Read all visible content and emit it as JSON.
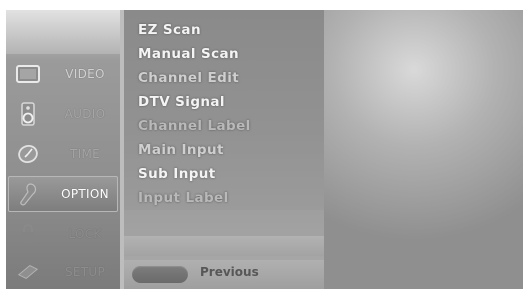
{
  "sidebar": {
    "items": [
      {
        "label": "VIDEO",
        "icon": "tv-screen-icon",
        "state": "normal"
      },
      {
        "label": "AUDIO",
        "icon": "speaker-icon",
        "state": "dim"
      },
      {
        "label": "TIME",
        "icon": "clock-icon",
        "state": "dim"
      },
      {
        "label": "OPTION",
        "icon": "option-icon",
        "state": "active"
      },
      {
        "label": "LOCK",
        "icon": "lock-icon",
        "state": "faint"
      },
      {
        "label": "SETUP",
        "icon": "setup-icon",
        "state": "faint"
      }
    ]
  },
  "menu": {
    "items": [
      "EZ Scan",
      "Manual Scan",
      "Channel Edit",
      "DTV Signal",
      "Channel Label",
      "Main Input",
      "Sub Input",
      "Input Label"
    ]
  },
  "footer": {
    "previous_label": "Previous"
  },
  "colors": {
    "background": "#9b9b9b",
    "text_primary": "#f4f4f4",
    "text_muted": "#575757"
  }
}
